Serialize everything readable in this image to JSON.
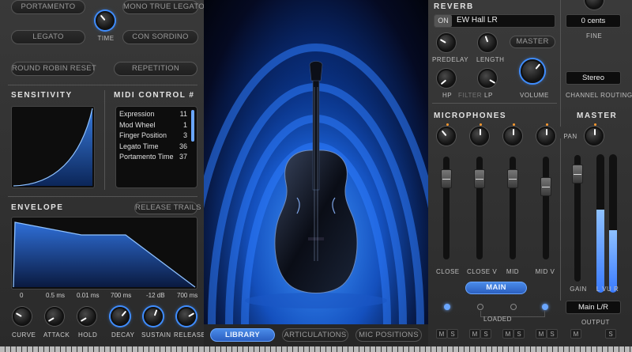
{
  "left": {
    "articulation_buttons": {
      "portamento": "PORTAMENTO",
      "mono_true_legato": "MONO TRUE LEGATO",
      "legato": "LEGATO",
      "con_sordino": "CON SORDINO",
      "round_robin_reset": "ROUND ROBIN RESET",
      "repetition": "REPETITION"
    },
    "time_label": "TIME",
    "sensitivity_title": "SENSITIVITY",
    "midi_control_title": "MIDI CONTROL #",
    "midi_controls": [
      {
        "name": "Expression",
        "value": "11"
      },
      {
        "name": "Mod Wheel",
        "value": "1"
      },
      {
        "name": "Finger Position",
        "value": "3"
      },
      {
        "name": "Legato Time",
        "value": "36"
      },
      {
        "name": "Portamento Time",
        "value": "37"
      }
    ],
    "envelope_title": "ENVELOPE",
    "release_trails": "RELEASE TRAILS",
    "envelope_values": [
      "0",
      "0.5 ms",
      "0.01 ms",
      "700 ms",
      "-12 dB",
      "700 ms"
    ],
    "knob_labels": [
      "CURVE",
      "ATTACK",
      "HOLD",
      "DECAY",
      "SUSTAIN",
      "RELEASE"
    ]
  },
  "center": {
    "tabs": [
      "LIBRARY",
      "ARTICULATIONS",
      "MIC POSITIONS"
    ],
    "active_tab": "LIBRARY"
  },
  "reverb": {
    "title": "REVERB",
    "on_label": "ON",
    "preset": "EW Hall LR",
    "master_button": "MASTER",
    "labels": {
      "predelay": "PREDELAY",
      "length": "LENGTH",
      "hp": "HP",
      "filter": "FILTER",
      "lp": "LP",
      "volume": "VOLUME"
    }
  },
  "microphones": {
    "title": "MICROPHONES",
    "channels": [
      "CLOSE",
      "CLOSE V",
      "MID",
      "MID V"
    ],
    "main_button": "MAIN",
    "loaded_label": "LOADED",
    "ms_labels": [
      "M",
      "S"
    ]
  },
  "master": {
    "fine_value": "0 cents",
    "fine_label": "FINE",
    "routing_value": "Stereo",
    "routing_label": "CHANNEL ROUTING",
    "title": "MASTER",
    "pan_label": "PAN",
    "gain_label": "GAIN",
    "vu_label": "L VU R",
    "output_value": "Main L/R",
    "output_label": "OUTPUT",
    "vu_levels": [
      0.6,
      0.45
    ]
  },
  "colors": {
    "accent_blue": "#3f8dff",
    "indicator_orange": "#ff9a2e"
  }
}
